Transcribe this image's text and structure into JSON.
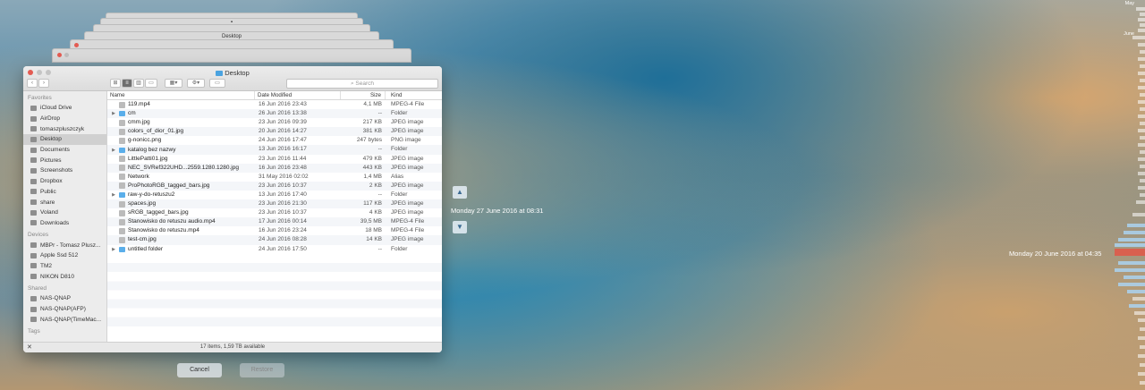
{
  "window": {
    "title": "Desktop",
    "back_stack_title": "Desktop",
    "search_placeholder": "Search",
    "status": "17 items, 1,59 TB available"
  },
  "sidebar": {
    "favorites_label": "Favorites",
    "favorites": [
      "iCloud Drive",
      "AirDrop",
      "tomaszpluszczyk",
      "Desktop",
      "Documents",
      "Pictures",
      "Screenshots",
      "Dropbox",
      "Public",
      "share",
      "Voland",
      "Downloads"
    ],
    "devices_label": "Devices",
    "devices": [
      "MBPr - Tomasz Plusz...",
      "Apple Ssd 512",
      "TM2",
      "NIKON D810"
    ],
    "shared_label": "Shared",
    "shared": [
      "NAS-QNAP",
      "NAS-QNAP(AFP)",
      "NAS-QNAP(TimeMac..."
    ],
    "tags_label": "Tags"
  },
  "columns": {
    "name": "Name",
    "date": "Date Modified",
    "size": "Size",
    "kind": "Kind"
  },
  "files": [
    {
      "name": "119.mp4",
      "date": "16 Jun 2016 23:43",
      "size": "4,1 MB",
      "kind": "MPEG-4 File",
      "folder": false
    },
    {
      "name": "cm",
      "date": "26 Jun 2016 13:38",
      "size": "--",
      "kind": "Folder",
      "folder": true
    },
    {
      "name": "cmm.jpg",
      "date": "23 Jun 2016 09:39",
      "size": "217 KB",
      "kind": "JPEG image",
      "folder": false
    },
    {
      "name": "colors_of_dior_01.jpg",
      "date": "20 Jun 2016 14:27",
      "size": "381 KB",
      "kind": "JPEG image",
      "folder": false
    },
    {
      "name": "g-nonicc.png",
      "date": "24 Jun 2016 17:47",
      "size": "247 bytes",
      "kind": "PNG image",
      "folder": false
    },
    {
      "name": "katalog bez nazwy",
      "date": "13 Jun 2016 16:17",
      "size": "--",
      "kind": "Folder",
      "folder": true
    },
    {
      "name": "LittlePatti01.jpg",
      "date": "23 Jun 2016 11:44",
      "size": "479 KB",
      "kind": "JPEG image",
      "folder": false
    },
    {
      "name": "NEC_SVRef322UHD...2559.1280.1280.jpg",
      "date": "16 Jun 2016 23:48",
      "size": "443 KB",
      "kind": "JPEG image",
      "folder": false
    },
    {
      "name": "Network",
      "date": "31 May 2016 02:02",
      "size": "1,4 MB",
      "kind": "Alias",
      "folder": false
    },
    {
      "name": "ProPhotoRGB_tagged_bars.jpg",
      "date": "23 Jun 2016 10:37",
      "size": "2 KB",
      "kind": "JPEG image",
      "folder": false
    },
    {
      "name": "raw-y-do-retuszu2",
      "date": "13 Jun 2016 17:40",
      "size": "--",
      "kind": "Folder",
      "folder": true
    },
    {
      "name": "spaces.jpg",
      "date": "23 Jun 2016 21:30",
      "size": "117 KB",
      "kind": "JPEG image",
      "folder": false
    },
    {
      "name": "sRGB_tagged_bars.jpg",
      "date": "23 Jun 2016 10:37",
      "size": "4 KB",
      "kind": "JPEG image",
      "folder": false
    },
    {
      "name": "Stanowisko do retuszu audio.mp4",
      "date": "17 Jun 2016 00:14",
      "size": "39,5 MB",
      "kind": "MPEG-4 File",
      "folder": false
    },
    {
      "name": "Stanowisko do retuszu.mp4",
      "date": "16 Jun 2016 23:24",
      "size": "18 MB",
      "kind": "MPEG-4 File",
      "folder": false
    },
    {
      "name": "test-cm.jpg",
      "date": "24 Jun 2016 08:28",
      "size": "14 KB",
      "kind": "JPEG image",
      "folder": false
    },
    {
      "name": "untitled folder",
      "date": "24 Jun 2016 17:50",
      "size": "--",
      "kind": "Folder",
      "folder": true
    }
  ],
  "buttons": {
    "cancel": "Cancel",
    "restore": "Restore"
  },
  "timemachine": {
    "current_date": "Monday 27 June 2016 at 08:31",
    "hover_date": "Monday 20 June 2016 at 04:35",
    "months": [
      "May",
      "June"
    ]
  },
  "colors": {
    "accent": "#d9604f",
    "folder": "#5aaeea"
  }
}
